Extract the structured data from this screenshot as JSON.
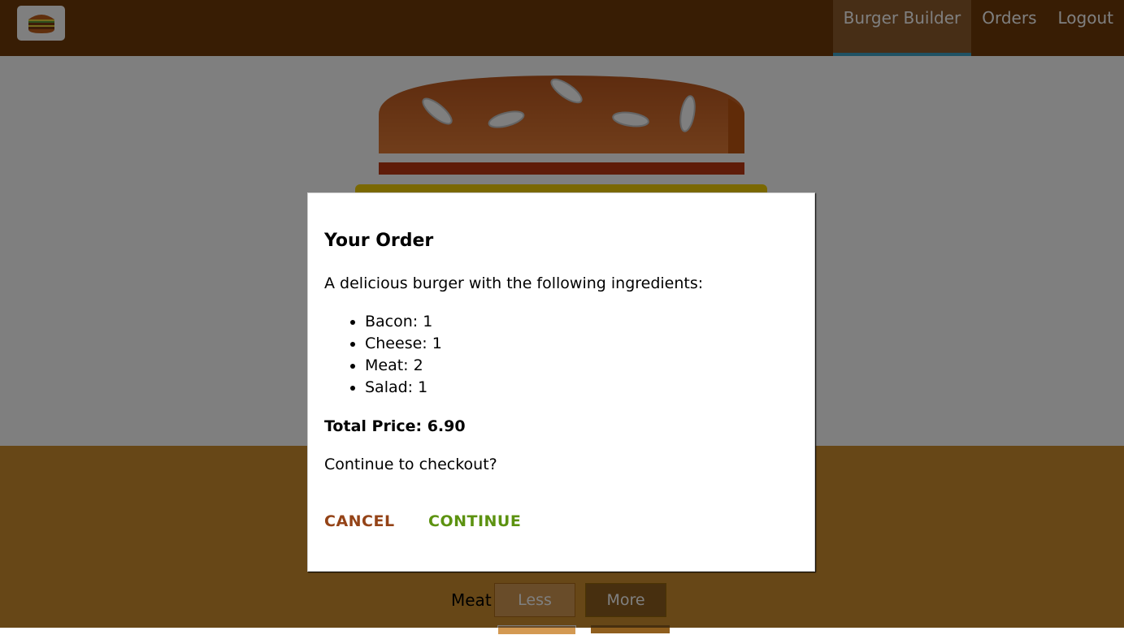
{
  "toolbar": {
    "logo_icon": "burger-logo-icon",
    "nav": [
      {
        "label": "Burger Builder",
        "active": true
      },
      {
        "label": "Orders",
        "active": false
      },
      {
        "label": "Logout",
        "active": false
      }
    ]
  },
  "controls": {
    "meat": {
      "label": "Meat",
      "less": "Less",
      "more": "More"
    }
  },
  "modal": {
    "title": "Your Order",
    "intro": "A delicious burger with the following ingredients:",
    "ingredients": [
      {
        "text": "Bacon: 1"
      },
      {
        "text": "Cheese: 1"
      },
      {
        "text": "Meat: 2"
      },
      {
        "text": "Salad: 1"
      }
    ],
    "total": "Total Price: 6.90",
    "question": "Continue to checkout?",
    "cancel": "CANCEL",
    "continue": "CONTINUE"
  },
  "colors": {
    "toolbar": "#703b09",
    "active_nav": "#8f5c2c",
    "active_underline": "#40a4c8",
    "controls_bg": "#cf8f2e",
    "cancel": "#944317",
    "continue": "#5c9210"
  }
}
